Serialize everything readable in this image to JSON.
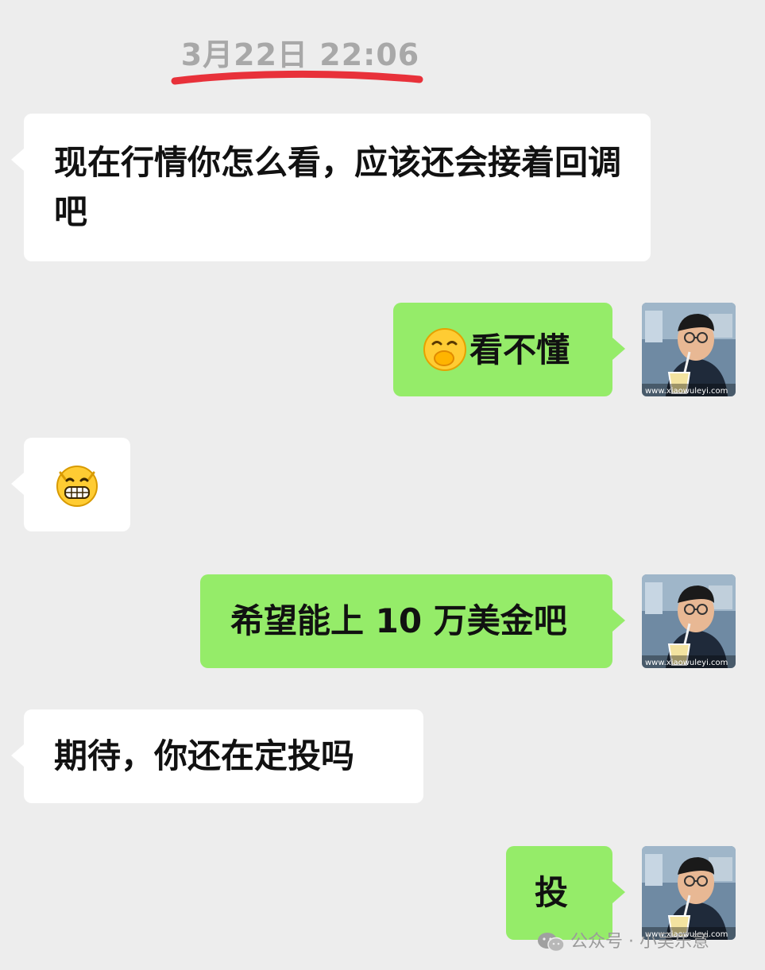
{
  "chat": {
    "timestamp": "3月22日 22:06",
    "messages": [
      {
        "side": "in",
        "text": "现在行情你怎么看，应该还会接着回调吧"
      },
      {
        "side": "out",
        "emoji": "face-with-hand-over-mouth-icon",
        "text": "看不懂"
      },
      {
        "side": "in",
        "emoji": "grinning-face-icon",
        "text": ""
      },
      {
        "side": "out",
        "text": "希望能上 10 万美金吧"
      },
      {
        "side": "in",
        "text": "期待，你还在定投吗"
      },
      {
        "side": "out",
        "text": "投"
      }
    ]
  },
  "avatar": {
    "watermark_text": "www.xiaowuleyi.com"
  },
  "watermark": {
    "text": "公众号 · 小吴乐意"
  },
  "colors": {
    "background": "#ededed",
    "incoming_bubble": "#ffffff",
    "outgoing_bubble": "#95ec69",
    "timestamp": "#a8a8a8",
    "annotation_underline": "#e8313a"
  }
}
